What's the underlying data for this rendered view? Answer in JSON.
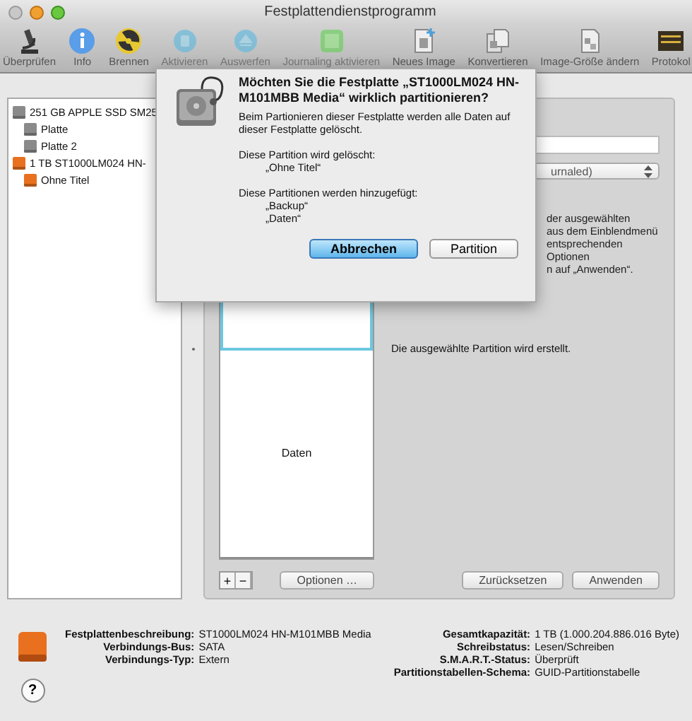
{
  "window": {
    "title": "Festplattendienstprogramm"
  },
  "toolbar": [
    {
      "label": "Überprüfen",
      "kind": "microscope",
      "disabled": false
    },
    {
      "label": "Info",
      "kind": "info",
      "disabled": false
    },
    {
      "label": "Brennen",
      "kind": "burn",
      "disabled": false
    },
    {
      "label": "Aktivieren",
      "kind": "mount",
      "disabled": true
    },
    {
      "label": "Auswerfen",
      "kind": "eject",
      "disabled": true
    },
    {
      "label": "Journaling aktivieren",
      "kind": "journal",
      "disabled": true
    },
    {
      "label": "Neues Image",
      "kind": "newimage",
      "disabled": false
    },
    {
      "label": "Konvertieren",
      "kind": "convert",
      "disabled": false
    },
    {
      "label": "Image-Größe ändern",
      "kind": "resize",
      "disabled": false
    },
    {
      "label": "Protokol",
      "kind": "log",
      "disabled": false
    }
  ],
  "sidebar": {
    "items": [
      {
        "label": "251 GB APPLE SSD SM25",
        "color": "#8a8a8a",
        "children": [
          {
            "label": "Platte",
            "color": "#8a8a8a"
          },
          {
            "label": "Platte 2",
            "color": "#8a8a8a"
          }
        ]
      },
      {
        "label": "1 TB ST1000LM024 HN-",
        "color": "#e8701e",
        "children": [
          {
            "label": "Ohne Titel",
            "color": "#e8701e"
          }
        ]
      }
    ]
  },
  "partition": {
    "map": [
      {
        "selected": true
      },
      {
        "label": "Daten",
        "selected": false
      }
    ],
    "format_popup": {
      "value": "urnaled)"
    },
    "description": [
      "der ausgewählten",
      "aus dem Einblendmenü",
      "entsprechenden Optionen",
      "n auf „Anwenden“."
    ],
    "status": "Die ausgewählte Partition wird erstellt.",
    "add_button": "+",
    "remove_button": "−",
    "options_button": "Optionen …",
    "revert_button": "Zurücksetzen",
    "apply_button": "Anwenden"
  },
  "info": {
    "left": [
      {
        "label": "Festplattenbeschreibung:",
        "value": "ST1000LM024 HN-M101MBB Media"
      },
      {
        "label": "Verbindungs-Bus:",
        "value": "SATA"
      },
      {
        "label": "Verbindungs-Typ:",
        "value": "Extern"
      }
    ],
    "right": [
      {
        "label": "Gesamtkapazität:",
        "value": "1 TB (1.000.204.886.016 Byte)"
      },
      {
        "label": "Schreibstatus:",
        "value": "Lesen/Schreiben"
      },
      {
        "label": "S.M.A.R.T.-Status:",
        "value": "Überprüft"
      },
      {
        "label": "Partitionstabellen-Schema:",
        "value": "GUID-Partitionstabelle"
      }
    ],
    "help": "?"
  },
  "dialog": {
    "title": "Möchten Sie die Festplatte „ST1000LM024 HN-M101MBB Media“ wirklich partitionieren?",
    "message": "Beim Partionieren dieser Festplatte werden alle Daten auf dieser Festplatte gelöscht.",
    "deleted_heading": "Diese Partition wird gelöscht:",
    "deleted": [
      "„Ohne Titel“"
    ],
    "added_heading": "Diese Partitionen werden hinzugefügt:",
    "added": [
      "„Backup“",
      "„Daten“"
    ],
    "buttons": [
      {
        "label": "Abbrechen",
        "default": true
      },
      {
        "label": "Partition",
        "default": false
      }
    ]
  }
}
